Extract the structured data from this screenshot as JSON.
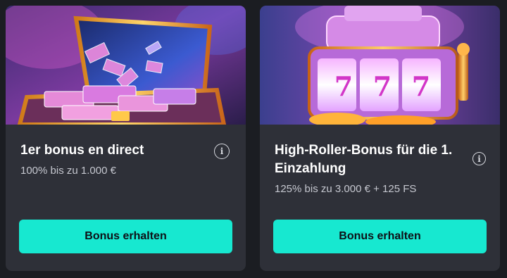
{
  "offers": [
    {
      "title": "1er bonus en direct",
      "subtitle": "100% bis zu 1.000 €",
      "cta_label": "Bonus erhalten",
      "banner_icon": "money-suitcase-illustration",
      "info_icon": "info-icon"
    },
    {
      "title": "High-Roller-Bonus für die 1. Einzahlung",
      "subtitle": "125% bis zu 3.000 € + 125 FS",
      "cta_label": "Bonus erhalten",
      "banner_icon": "slot-machine-illustration",
      "info_icon": "info-icon"
    }
  ],
  "info_glyph": "i",
  "reel_symbol": "7",
  "colors": {
    "page_bg": "#1b1d22",
    "card_bg": "#2e3038",
    "accent": "#17e8d0",
    "title": "#ffffff",
    "subtitle": "#c5c7cf"
  }
}
